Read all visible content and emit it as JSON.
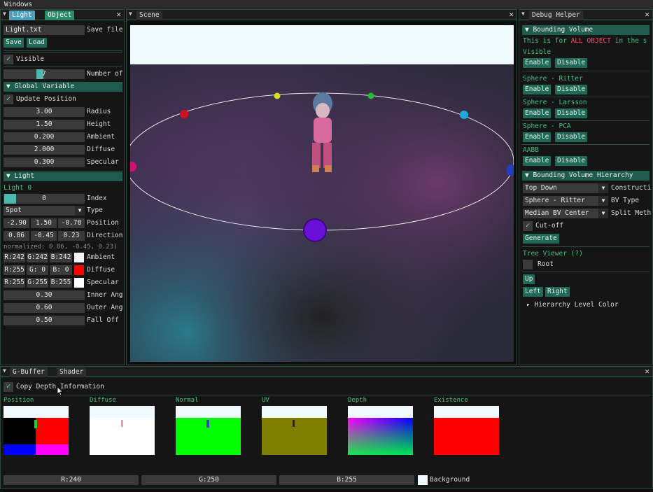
{
  "menubar": {
    "title": "Windows"
  },
  "left_panel": {
    "tabs": [
      "Light",
      "Object"
    ],
    "file_name": "Light.txt",
    "save_file_label": "Save file",
    "save_label": "Save",
    "load_label": "Load",
    "visible_label": "Visible",
    "number_value": "7",
    "number_label": "Number of",
    "global_header": "Global Variable",
    "update_position_label": "Update Position",
    "globals": [
      {
        "value": "3.00",
        "label": "Radius"
      },
      {
        "value": "1.50",
        "label": "Height"
      },
      {
        "value": "0.200",
        "label": "Ambient"
      },
      {
        "value": "2.000",
        "label": "Diffuse"
      },
      {
        "value": "0.300",
        "label": "Specular"
      }
    ],
    "light_header": "Light",
    "light_name": "Light 0",
    "index_value": "0",
    "index_label": "Index",
    "type_value": "Spot",
    "type_label": "Type",
    "position": {
      "x": "-2.90",
      "y": "1.50",
      "z": "-0.78",
      "label": "Position"
    },
    "direction": {
      "x": "0.86",
      "y": "-0.45",
      "z": "0.23",
      "label": "Direction"
    },
    "normalized": "normalized: 0.86, -0.45, 0.23)",
    "ambient": {
      "r": "R:242",
      "g": "G:242",
      "b": "B:242",
      "label": "Ambient",
      "color": "#f2f2f2"
    },
    "diffuse": {
      "r": "R:255",
      "g": "G:  0",
      "b": "B:  0",
      "label": "Diffuse",
      "color": "#ff0000"
    },
    "specular": {
      "r": "R:255",
      "g": "G:255",
      "b": "B:255",
      "label": "Specular",
      "color": "#ffffff"
    },
    "angles": [
      {
        "value": "0.30",
        "label": "Inner Ang"
      },
      {
        "value": "0.60",
        "label": "Outer Ang"
      },
      {
        "value": "0.50",
        "label": "Fall Off"
      }
    ]
  },
  "scene": {
    "tab": "Scene"
  },
  "debug": {
    "tab": "Debug Helper",
    "bv_header": "Bounding Volume",
    "info_prefix": "This is for",
    "info_highlight": "ALL OBJECT",
    "info_suffix": "in the s",
    "groups": [
      "Visible",
      "Sphere - Ritter",
      "Sphere - Larsson",
      "Sphere - PCA",
      "AABB"
    ],
    "enable_label": "Enable",
    "disable_label": "Disable",
    "bvh_header": "Bounding Volume Hierarchy",
    "construction_value": "Top Down",
    "construction_label": "Constructi",
    "bvtype_value": "Sphere - Ritter",
    "bvtype_label": "BV Type",
    "split_value": "Median BV Center",
    "split_label": "Split Meth",
    "cutoff_label": "Cut-off",
    "generate_label": "Generate",
    "tree_viewer_label": "Tree Viewer (?)",
    "root_label": "Root",
    "up_label": "Up",
    "left_label": "Left",
    "right_label": "Right",
    "level_color_label": "Hierarchy Level Color"
  },
  "gbuffer": {
    "tabs": [
      "G-Buffer",
      "Shader"
    ],
    "copy_depth_label": "Copy Depth Information",
    "buffers": [
      "Position",
      "Diffuse",
      "Normal",
      "UV",
      "Depth",
      "Existence"
    ],
    "bg": {
      "r": "R:240",
      "g": "G:250",
      "b": "B:255",
      "label": "Background",
      "color": "#f0faff"
    }
  }
}
